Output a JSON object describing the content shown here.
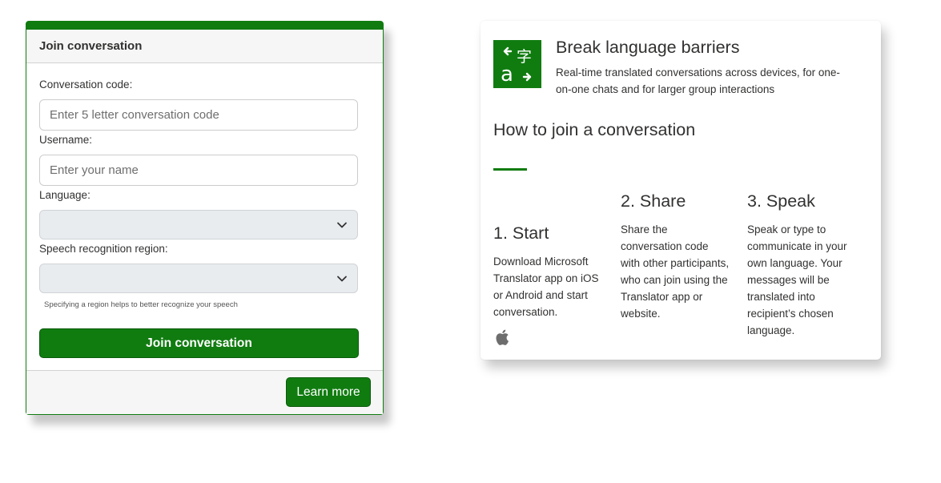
{
  "join": {
    "header": "Join conversation",
    "code_label": "Conversation code:",
    "code_placeholder": "Enter 5 letter conversation code",
    "username_label": "Username:",
    "username_placeholder": "Enter your name",
    "language_label": "Language:",
    "language_value": "",
    "region_label": "Speech recognition region:",
    "region_value": "",
    "region_hint": "Specifying a region helps to better recognize your speech",
    "join_button": "Join conversation",
    "learn_more_button": "Learn more"
  },
  "info": {
    "title": "Break language barriers",
    "subtitle": "Real-time translated conversations across devices, for one-on-one chats and for larger group interactions",
    "how_title": "How to join a conversation",
    "steps": [
      {
        "heading": "1. Start",
        "text": "Download Microsoft Translator app on iOS or Android and start conversation."
      },
      {
        "heading": "2. Share",
        "text": "Share the conversation code with other participants, who can join using the Translator app or website."
      },
      {
        "heading": "3. Speak",
        "text": "Speak or type to communicate in your own language. Your messages will be translated into recipient’s chosen language."
      }
    ],
    "logo_glyph_latin": "a",
    "logo_glyph_cjk": "字"
  },
  "colors": {
    "accent": "#107c10",
    "panel": "#f6f6f6",
    "text": "#323130"
  },
  "icons": [
    "translator-logo-icon",
    "chevron-down-icon",
    "apple-icon"
  ]
}
